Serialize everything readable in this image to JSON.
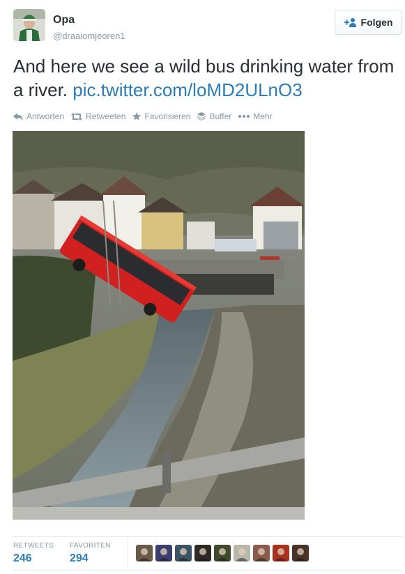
{
  "user": {
    "name": "Opa",
    "handle": "@draaiomjeoren1",
    "avatar_icon": "profile-avatar"
  },
  "follow": {
    "label": "Folgen",
    "icon": "follow-person-plus-icon",
    "accent": "#2b7bb9"
  },
  "tweet": {
    "text": "And here we see a wild bus drinking water from a river. ",
    "link": "pic.twitter.com/loMD2ULnO3"
  },
  "actions": [
    {
      "label": "Antworten",
      "icon": "reply-icon"
    },
    {
      "label": "Retweeten",
      "icon": "retweet-icon"
    },
    {
      "label": "Favorisieren",
      "icon": "star-icon"
    },
    {
      "label": "Buffer",
      "icon": "buffer-icon"
    },
    {
      "label": "Mehr",
      "icon": "more-dots-icon"
    }
  ],
  "stats": {
    "retweets_label": "RETWEETS",
    "retweets": "246",
    "favorites_label": "FAVORITEN",
    "favorites": "294"
  },
  "favoriters": [
    {
      "icon": "user-avatar-1",
      "color": "#6a5a48"
    },
    {
      "icon": "user-avatar-2",
      "color": "#3a3f6d"
    },
    {
      "icon": "user-avatar-3",
      "color": "#3b5566"
    },
    {
      "icon": "user-avatar-4",
      "color": "#2e2925"
    },
    {
      "icon": "user-avatar-5",
      "color": "#3f4a2c"
    },
    {
      "icon": "user-avatar-6",
      "color": "#b7b7aa"
    },
    {
      "icon": "user-avatar-7",
      "color": "#8a5a4a"
    },
    {
      "icon": "user-avatar-8",
      "color": "#a8321e"
    },
    {
      "icon": "user-avatar-9",
      "color": "#4a3328"
    }
  ]
}
